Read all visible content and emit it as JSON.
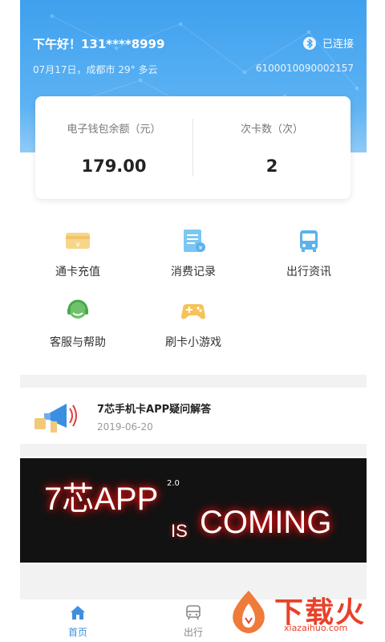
{
  "header": {
    "greeting": "下午好！131****8999",
    "bluetooth_status": "已连接",
    "location_info": "07月17日，成都市 29° 多云",
    "card_number": "6100010090002157"
  },
  "balance_card": {
    "wallet_label": "电子钱包余额（元）",
    "wallet_value": "179.00",
    "count_label": "次卡数（次）",
    "count_value": "2"
  },
  "services": [
    {
      "label": "通卡充值",
      "icon": "card-recharge-icon"
    },
    {
      "label": "消费记录",
      "icon": "records-icon"
    },
    {
      "label": "出行资讯",
      "icon": "bus-icon"
    },
    {
      "label": "客服与帮助",
      "icon": "customer-service-icon"
    },
    {
      "label": "刷卡小游戏",
      "icon": "gamepad-icon"
    }
  ],
  "news": {
    "title": "7芯手机卡APP疑问解答",
    "date": "2019-06-20",
    "icon": "megaphone-icon"
  },
  "banner": {
    "line1": "7芯APP",
    "version": "2.0",
    "is": "IS",
    "coming": "COMING"
  },
  "tabs": [
    {
      "label": "首页",
      "icon": "home-icon",
      "active": true
    },
    {
      "label": "出行",
      "icon": "transit-icon",
      "active": false
    }
  ],
  "watermark": {
    "main": "下载火",
    "sub": "xiazaihuo.com"
  },
  "colors": {
    "header_blue": "#3fa0ee",
    "tab_active": "#3d8fe0",
    "watermark": "#e8412a"
  }
}
